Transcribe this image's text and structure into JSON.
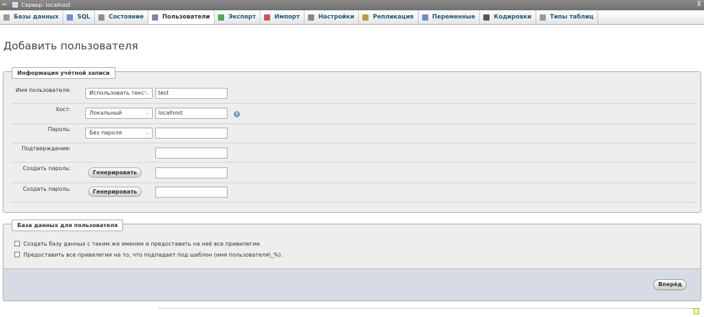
{
  "topbar": {
    "back_icon": "←",
    "server_label": "Сервер: localhost",
    "collapse_icon": "⊼"
  },
  "tabs": [
    {
      "label": "Базы данных",
      "icon": "database-icon",
      "color": "#9a9a9a"
    },
    {
      "label": "SQL",
      "icon": "sql-icon",
      "color": "#6e90c8"
    },
    {
      "label": "Состояние",
      "icon": "status-icon",
      "color": "#8a8f99"
    },
    {
      "label": "Пользователи",
      "icon": "users-icon",
      "color": "#7a8aa6",
      "active": true
    },
    {
      "label": "Экспорт",
      "icon": "export-icon",
      "color": "#5aa55a"
    },
    {
      "label": "Импорт",
      "icon": "import-icon",
      "color": "#c05a5a"
    },
    {
      "label": "Настройки",
      "icon": "settings-icon",
      "color": "#888888"
    },
    {
      "label": "Репликация",
      "icon": "replication-icon",
      "color": "#b89a4a"
    },
    {
      "label": "Переменные",
      "icon": "variables-icon",
      "color": "#6b8cc7"
    },
    {
      "label": "Кодировки",
      "icon": "charsets-icon",
      "color": "#555555"
    },
    {
      "label": "Типы таблиц",
      "icon": "engines-icon",
      "color": "#9a9a9a"
    }
  ],
  "page": {
    "title": "Добавить пользователя"
  },
  "account": {
    "legend": "Информация учётной записи",
    "username_label": "Имя пользователя:",
    "username_mode": "Использовать текстовое поле",
    "username_value": "test",
    "host_label": "Хост:",
    "host_mode": "Локальный",
    "host_value": "localhost",
    "password_label": "Пароль:",
    "password_mode": "Без пароля",
    "password_value": "",
    "confirm_label": "Подтверждение:",
    "confirm_value": "",
    "generate1_label": "Создать пароль:",
    "generate1_button": "Генерировать",
    "generate2_label": "Создать пароль:",
    "generate2_button": "Генерировать"
  },
  "database": {
    "legend": "База данных для пользователя",
    "option1": "Создать базу данных с таким же именем и предоставить на неё все привилегии.",
    "option2": "Предоставить все привилегии на то, что подпадает под шаблон (имя пользователя\\_%)."
  },
  "footer": {
    "go_button": "Вперёд"
  }
}
